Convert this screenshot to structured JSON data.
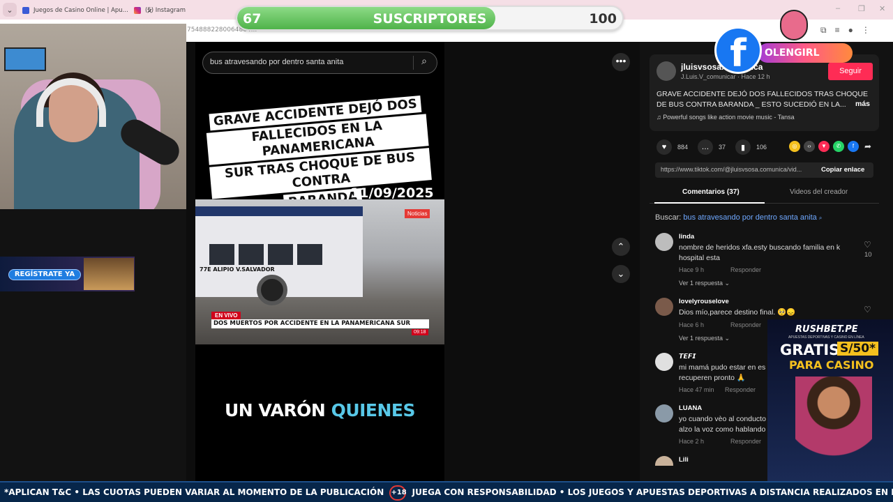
{
  "browser": {
    "tabs": [
      {
        "label": "Juegos de Casino Online | Apu..."
      },
      {
        "label": "(5) Instagram"
      }
    ],
    "url_fragment": "7548882280064864..."
  },
  "subscribers": {
    "current": "67",
    "label": "SUSCRIPTORES",
    "goal": "100",
    "progress": 0.67
  },
  "search": {
    "query": "bus atravesando por dentro santa anita"
  },
  "video": {
    "headline_lines": [
      "GRAVE ACCIDENTE DEJÓ DOS",
      "FALLECIDOS EN LA PANAMERICANA",
      "SUR TRAS CHOQUE DE BUS CONTRA",
      "BARANDA"
    ],
    "date": "11/09/2025",
    "photo_tag": "Noticias",
    "bus_route": "77E ALIPIO   V.SALVADOR",
    "live_label": "EN VIVO",
    "ticker": "DOS MUERTOS POR ACCIDENTE EN LA PANAMERICANA SUR",
    "ticker_time": "09:18",
    "caption_plain": "UN VARÓN",
    "caption_highlight": "QUIENES"
  },
  "post": {
    "author": "jluisvsosa.comunica",
    "author_sub": "J.Luis.V_comunicar · Hace 12 h",
    "follow_label": "Seguir",
    "description": "GRAVE ACCIDENTE DEJÓ DOS FALLECIDOS TRAS CHOQUE DE BUS CONTRA BARANDA _ ESTO SUCEDIÓ EN LA...",
    "more_label": "más",
    "music": "♫  Powerful songs like action movie music - Tansa",
    "likes": "884",
    "comments": "37",
    "saves": "106",
    "link": "https://www.tiktok.com/@jluisvsosa.comunica/vid...",
    "copy_label": "Copiar enlace",
    "tab_comments": "Comentarios (37)",
    "tab_videos": "Videos del creador",
    "search_prefix": "Buscar:",
    "search_query": "bus atravesando por dentro santa anita"
  },
  "comments": [
    {
      "user": "linda",
      "text": "nombre de heridos xfa.esty buscando familia en k hospital esta",
      "time": "Hace 9 h",
      "reply": "Responder",
      "more": "Ver 1 respuesta ⌄",
      "likes": "10"
    },
    {
      "user": "lovelyrouselove",
      "text": "Dios mío,parece destino final. 🥺😞",
      "time": "Hace 6 h",
      "reply": "Responder",
      "more": "Ver 1 respuesta ⌄",
      "likes": ""
    },
    {
      "user": "𝙏𝙀𝙁𝙄",
      "text": "mi mamá pudo estar en es recuperen pronto 🙏",
      "time": "Hace 47 min",
      "reply": "Responder",
      "more": "",
      "likes": ""
    },
    {
      "user": "LUANA",
      "text": "yo cuando vèo al conducto alzo la voz como hablando",
      "time": "Hace 2 h",
      "reply": "Responder",
      "more": "",
      "likes": ""
    },
    {
      "user": "Lili",
      "text": "",
      "time": "",
      "reply": "",
      "more": "",
      "likes": ""
    }
  ],
  "overlays": {
    "fb_letter": "f",
    "fb_name": "OLENGIRL",
    "register_label": "REGÍSTRATE YA",
    "rush_logo": "RUSHBET.PE",
    "rush_sub": "APUESTAS DEPORTIVAS Y CASINO EN LÍNEA",
    "rush_gratis": "GRATIS",
    "rush_amount": "S/50*",
    "rush_casino": "PARA CASINO"
  },
  "bottom": {
    "left": "*APLICAN T&C • LAS CUOTAS PUEDEN VARIAR AL MOMENTO DE LA PUBLICACIÓN",
    "badge": "+18",
    "right": "JUEGA CON RESPONSABILIDAD • LOS JUEGOS Y APUESTAS DEPORTIVAS A DISTANCIA REALIZADOS EN EXCESO PUEDEN CAUSAR LUDOPATÍA • PROHIBIDO A MENORES DE EDAD."
  },
  "colors": {
    "accent": "#fe2c55",
    "facebook": "#1877f2",
    "subs_fill": "#4fb34a"
  }
}
